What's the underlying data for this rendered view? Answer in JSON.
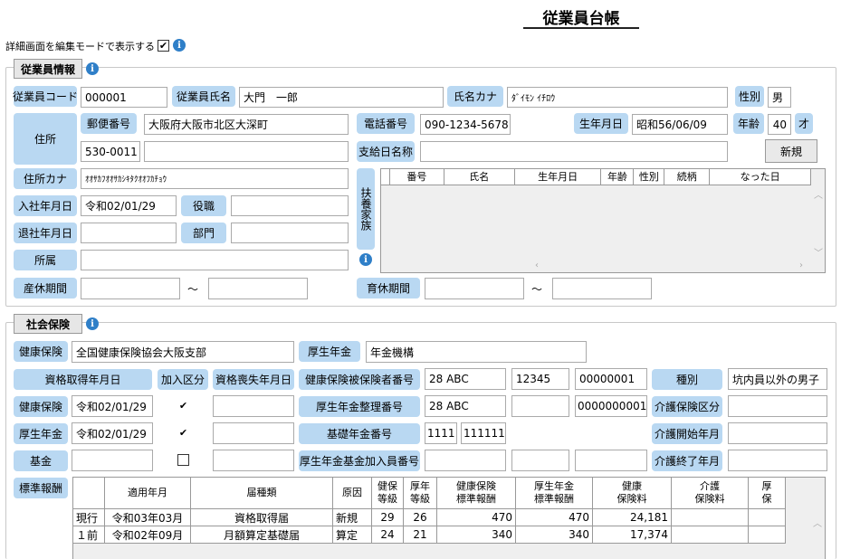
{
  "title": "従業員台帳",
  "edit_mode_label": "詳細画面を編集モードで表示する",
  "edit_mode_checked": true,
  "employee": {
    "section_label": "従業員情報",
    "code_label": "従業員コード",
    "code_value": "000001",
    "name_label": "従業員氏名",
    "name_value": "大門　一郎",
    "kana_label": "氏名カナ",
    "kana_value": "ﾀﾞｲﾓﾝ ｲﾁﾛｳ",
    "gender_label": "性別",
    "gender_value": "男",
    "address_label": "住所",
    "postal_label": "郵便番号",
    "address1_value": "大阪府大阪市北区大深町",
    "postal_value": "530-0011",
    "address2_value": "",
    "phone_label": "電話番号",
    "phone_value": "090-1234-5678",
    "birth_label": "生年月日",
    "birth_value": "昭和56/06/09",
    "age_label": "年齢",
    "age_value": "40",
    "age_unit": "才",
    "payday_label": "支給日名称",
    "payday_value": "",
    "new_button": "新規",
    "address_kana_label": "住所カナ",
    "address_kana_value": "ｵｵｻｶﾌｵｵｻｶｼｷﾀｸｵｵﾌｶﾁｮｳ",
    "join_label": "入社年月日",
    "join_value": "令和02/01/29",
    "post_label": "役職",
    "post_value": "",
    "leave_label": "退社年月日",
    "leave_value": "",
    "dept_label": "部門",
    "dept_value": "",
    "affil_label": "所属",
    "affil_value": "",
    "maternity_label": "産休期間",
    "tilde": "～",
    "childcare_label": "育休期間",
    "dependents_label": "扶養家族",
    "dependents_columns": [
      "番号",
      "氏名",
      "生年月日",
      "年齢",
      "性別",
      "続柄",
      "なった日"
    ]
  },
  "social": {
    "section_label": "社会保険",
    "health_ins_label": "健康保険",
    "health_ins_value": "全国健康保険協会大阪支部",
    "pension_label": "厚生年金",
    "pension_value": "年金機構",
    "acquired_label": "資格取得年月日",
    "join_kind_label": "加入区分",
    "lost_label": "資格喪失年月日",
    "insured_no_label": "健康保険被保険者番号",
    "insured_no_1": "28 ABC",
    "insured_no_2": "12345",
    "insured_no_3": "00000001",
    "kind_label": "種別",
    "kind_value": "坑内員以外の男子",
    "row_health_label": "健康保険",
    "row_health_date": "令和02/01/29",
    "pension_no_label": "厚生年金整理番号",
    "pension_no_1": "28 ABC",
    "pension_no_2": "0000000001",
    "care_label": "介護保険区分",
    "row_pension_label": "厚生年金",
    "row_pension_date": "令和02/01/29",
    "basic_no_label": "基礎年金番号",
    "basic_no_1": "1111",
    "basic_no_2": "111111",
    "care_start_label": "介護開始年月",
    "fund_label": "基金",
    "fund_member_label": "厚生年金基金加入員番号",
    "care_end_label": "介護終了年月",
    "standard_label": "標準報酬",
    "table_columns": [
      "",
      "適用年月",
      "届種類",
      "原因",
      "健保\n等級",
      "厚年\n等級",
      "健康保険\n標準報酬",
      "厚生年金\n標準報酬",
      "健康\n保険料",
      "介護\n保険料",
      "厚\n保"
    ],
    "table_rows": [
      [
        "現行",
        "令和03年03月",
        "資格取得届",
        "新規",
        "29",
        "26",
        "470",
        "470",
        "24,181",
        "",
        ""
      ],
      [
        "１前",
        "令和02年09月",
        "月額算定基礎届",
        "算定",
        "24",
        "21",
        "340",
        "340",
        "17,374",
        "",
        ""
      ]
    ]
  }
}
